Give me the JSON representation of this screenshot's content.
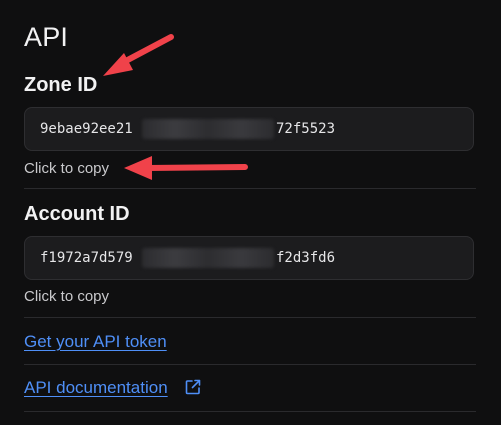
{
  "api": {
    "title": "API"
  },
  "zone": {
    "label": "Zone ID",
    "id_prefix": "9ebae92ee21",
    "id_suffix": "72f5523",
    "copy_hint": "Click to copy"
  },
  "account": {
    "label": "Account ID",
    "id_prefix": "f1972a7d579",
    "id_suffix": "f2d3fd6",
    "copy_hint": "Click to copy"
  },
  "links": {
    "token": "Get your API token",
    "docs": "API documentation"
  },
  "icons": {
    "external": "external-link-icon",
    "annotation_arrow": "arrow-annotation-icon"
  },
  "colors": {
    "background": "#0f0f10",
    "link": "#4f8ff7",
    "annotation_arrow": "#f0424a"
  }
}
